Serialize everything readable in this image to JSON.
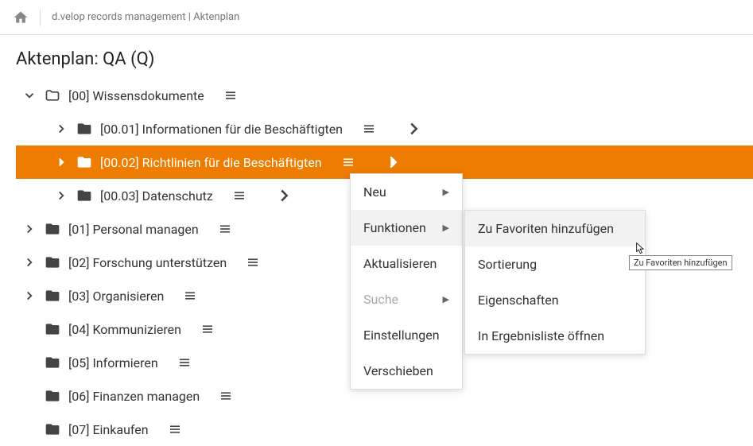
{
  "header": {
    "breadcrumb": "d.velop records management | Aktenplan"
  },
  "page": {
    "title": "Aktenplan: QA (Q)"
  },
  "tree": {
    "root": {
      "label": "[00] Wissensdokumente"
    },
    "children": [
      {
        "label": "[00.01] Informationen für die Beschäftigten"
      },
      {
        "label": "[00.02] Richtlinien für die Beschäftigten"
      },
      {
        "label": "[00.03] Datenschutz"
      }
    ],
    "siblings": [
      {
        "label": "[01] Personal managen"
      },
      {
        "label": "[02] Forschung unterstützen"
      },
      {
        "label": "[03] Organisieren"
      },
      {
        "label": "[04] Kommunizieren"
      },
      {
        "label": "[05] Informieren"
      },
      {
        "label": "[06] Finanzen managen"
      },
      {
        "label": "[07] Einkaufen"
      }
    ]
  },
  "contextMenu": {
    "primary": {
      "neu": "Neu",
      "funktionen": "Funktionen",
      "aktualisieren": "Aktualisieren",
      "suche": "Suche",
      "einstellungen": "Einstellungen",
      "verschieben": "Verschieben"
    },
    "secondary": {
      "favoriten": "Zu Favoriten hinzufügen",
      "sortierung": "Sortierung",
      "eigenschaften": "Eigenschaften",
      "ergebnisliste": "In Ergebnisliste öffnen"
    }
  },
  "tooltip": {
    "text": "Zu Favoriten hinzufügen"
  }
}
